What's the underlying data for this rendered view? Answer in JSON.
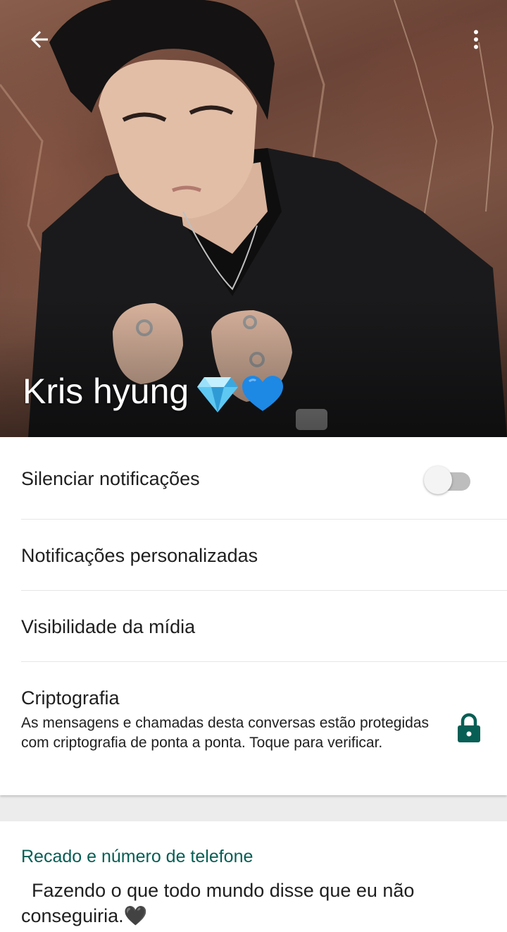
{
  "header": {
    "contact_name": "Kris hyung",
    "name_emojis": [
      "💎",
      "💙"
    ],
    "back_icon": "arrow-left-icon",
    "menu_icon": "more-vertical-icon"
  },
  "settings": {
    "mute_label": "Silenciar notificações",
    "mute_enabled": false,
    "custom_notifications_label": "Notificações personalizadas",
    "media_visibility_label": "Visibilidade da mídia",
    "encryption_label": "Criptografia",
    "encryption_description": "As mensagens e chamadas desta conversas estão protegidas com criptografia de ponta a ponta. Toque para verificar.",
    "encryption_icon": "lock-icon"
  },
  "about": {
    "title": "Recado e número de telefone",
    "text": "  Fazendo o que todo mundo disse que eu não conseguiria.🖤"
  },
  "colors": {
    "accent": "#075e54",
    "lock": "#075e54",
    "toggle_off_track": "#bdbdbd"
  }
}
